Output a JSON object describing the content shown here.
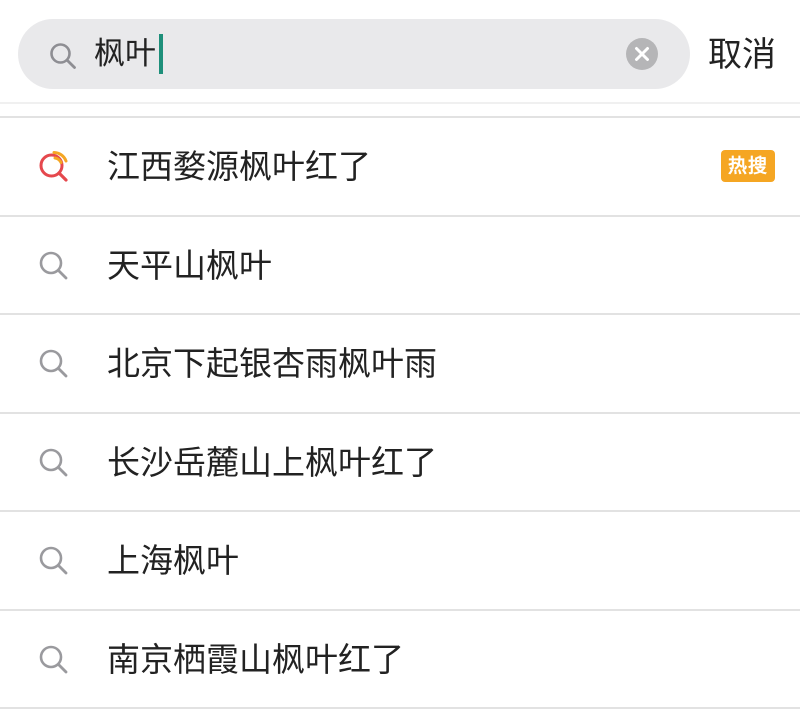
{
  "search": {
    "value": "枫叶",
    "cancel_label": "取消",
    "icon": "search-icon",
    "clear_icon": "clear-icon"
  },
  "suggestions": [
    {
      "text": "江西婺源枫叶红了",
      "icon": "hot-search-icon",
      "badge": "热搜"
    },
    {
      "text": "天平山枫叶",
      "icon": "search-icon"
    },
    {
      "text": "北京下起银杏雨枫叶雨",
      "icon": "search-icon"
    },
    {
      "text": "长沙岳麓山上枫叶红了",
      "icon": "search-icon"
    },
    {
      "text": "上海枫叶",
      "icon": "search-icon"
    },
    {
      "text": "南京栖霞山枫叶红了",
      "icon": "search-icon"
    }
  ],
  "colors": {
    "search_box_bg": "#e9e9eb",
    "caret": "#1e8f7a",
    "hot_badge": "#f5a623",
    "hot_icon_ring": "#e5484d",
    "hot_icon_accent": "#f5a623",
    "divider": "#e2e2e2",
    "text": "#222222"
  }
}
